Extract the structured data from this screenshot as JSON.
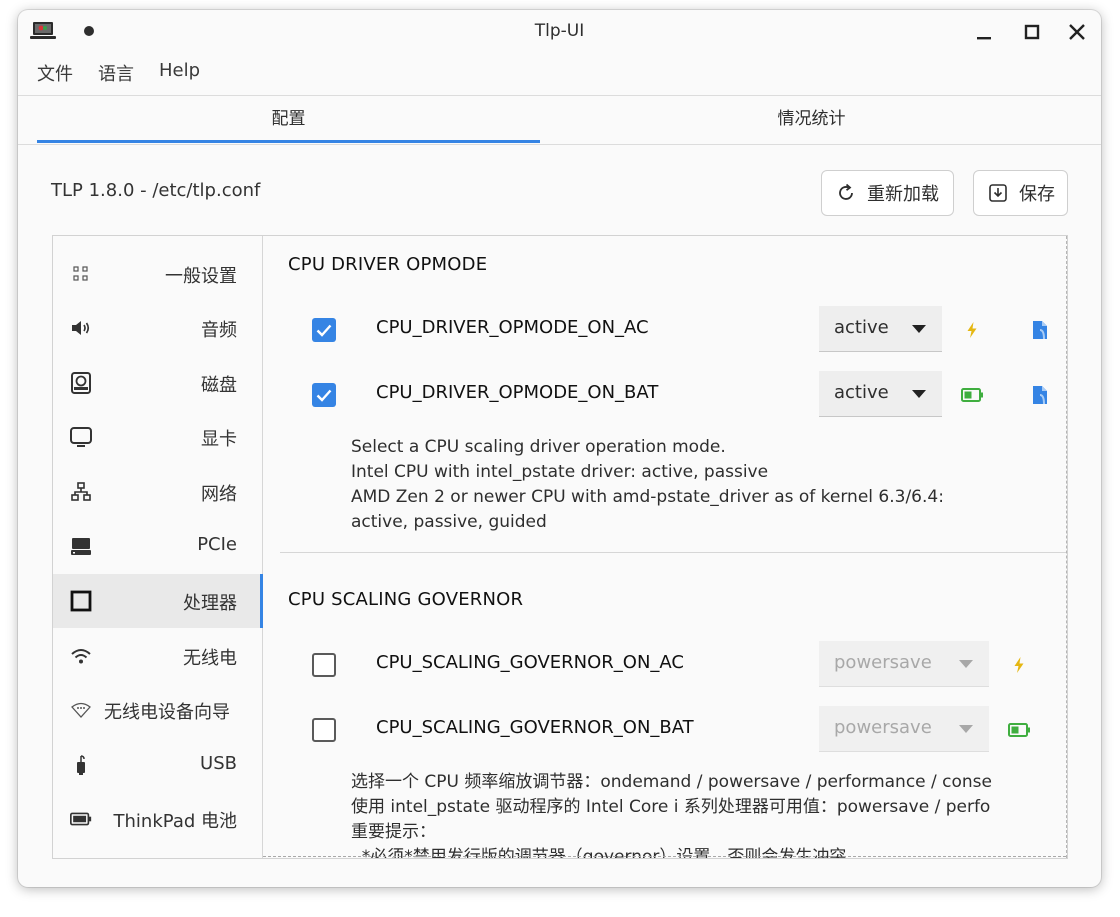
{
  "window": {
    "title": "Tlp-UI"
  },
  "menu": [
    "文件",
    "语言",
    "Help"
  ],
  "tabs": [
    {
      "label": "配置",
      "active": true
    },
    {
      "label": "情况统计",
      "active": false
    }
  ],
  "config_path": "TLP 1.8.0 - /etc/tlp.conf",
  "buttons": {
    "reload": "重新加载",
    "save": "保存"
  },
  "sidebar": {
    "items": [
      {
        "label": "一般设置",
        "icon": "grid-icon"
      },
      {
        "label": "音频",
        "icon": "speaker-icon"
      },
      {
        "label": "磁盘",
        "icon": "disk-icon"
      },
      {
        "label": "显卡",
        "icon": "display-icon"
      },
      {
        "label": "网络",
        "icon": "network-icon"
      },
      {
        "label": "PCIe",
        "icon": "pcie-icon"
      },
      {
        "label": "处理器",
        "icon": "cpu-icon",
        "active": true
      },
      {
        "label": "无线电",
        "icon": "wifi-icon"
      },
      {
        "label": "无线电设备向导",
        "icon": "wifi-wizard-icon"
      },
      {
        "label": "USB",
        "icon": "usb-icon"
      },
      {
        "label": "ThinkPad 电池",
        "icon": "battery-icon"
      }
    ]
  },
  "sections": [
    {
      "title": "CPU DRIVER OPMODE",
      "rows": [
        {
          "param": "CPU_DRIVER_OPMODE_ON_AC",
          "checked": true,
          "value": "active",
          "power_icon": "ac-power-icon",
          "has_doc_icon": true
        },
        {
          "param": "CPU_DRIVER_OPMODE_ON_BAT",
          "checked": true,
          "value": "active",
          "power_icon": "battery-power-icon",
          "has_doc_icon": true
        }
      ],
      "description": [
        "Select a CPU scaling driver operation mode.",
        "Intel CPU with intel_pstate driver: active, passive",
        "AMD Zen 2 or newer CPU with amd-pstate_driver as of kernel 6.3/6.4:",
        "active, passive, guided"
      ]
    },
    {
      "title": "CPU SCALING GOVERNOR",
      "rows": [
        {
          "param": "CPU_SCALING_GOVERNOR_ON_AC",
          "checked": false,
          "value": "powersave",
          "power_icon": "ac-power-icon"
        },
        {
          "param": "CPU_SCALING_GOVERNOR_ON_BAT",
          "checked": false,
          "value": "powersave",
          "power_icon": "battery-power-icon"
        }
      ],
      "description": [
        "选择一个 CPU 频率缩放调节器：ondemand / powersave / performance / conse",
        "使用 intel_pstate 驱动程序的 Intel Core i 系列处理器可用值：powersave / perfo",
        "重要提示：",
        "  *必须*禁用发行版的调节器（governor）设置，否则会发生冲突"
      ]
    }
  ],
  "colors": {
    "accent": "#3584e4",
    "ac_icon": "#e5b712",
    "battery_icon": "#3fae3f"
  }
}
